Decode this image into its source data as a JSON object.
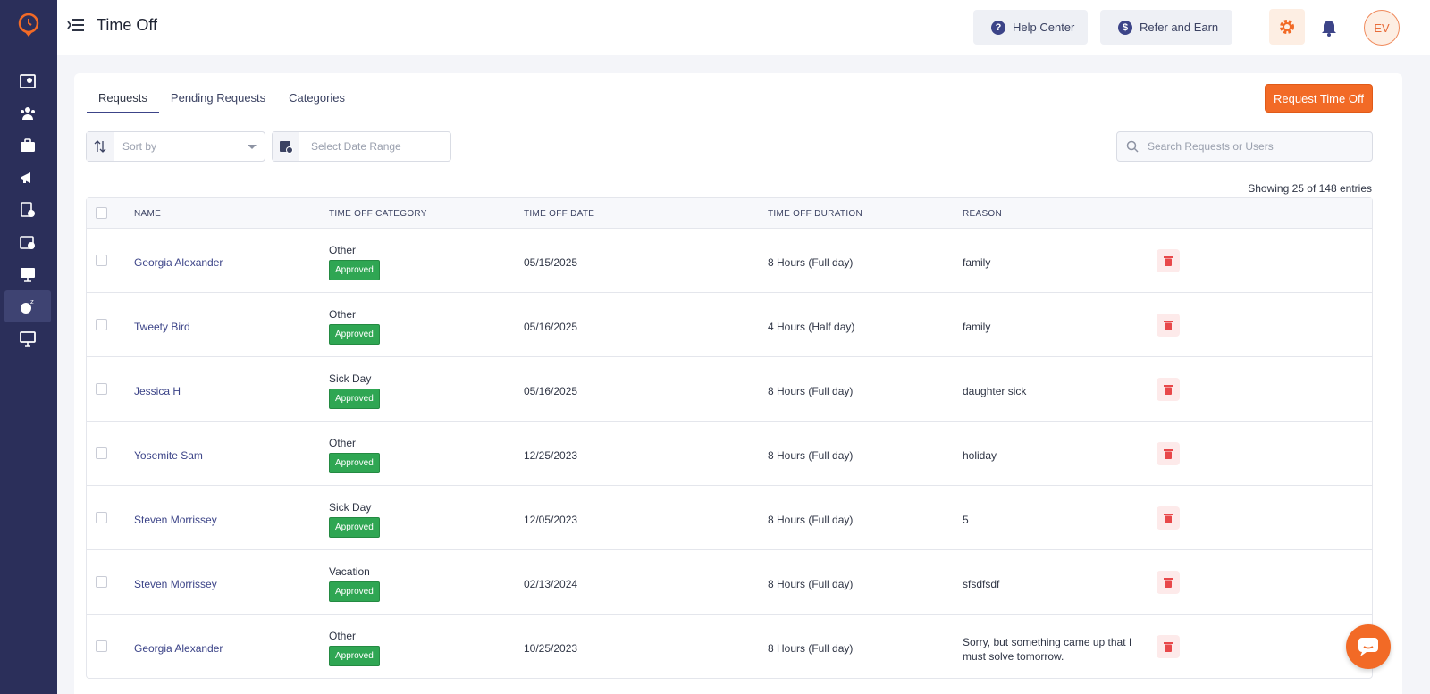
{
  "app": {
    "page_title": "Time Off",
    "accent_color": "#f26a26",
    "sidebar_color": "#2b2f5a"
  },
  "header": {
    "help_label": "Help Center",
    "refer_label": "Refer and Earn",
    "avatar_initials": "EV"
  },
  "tabs": [
    {
      "label": "Requests",
      "active": true
    },
    {
      "label": "Pending Requests",
      "active": false
    },
    {
      "label": "Categories",
      "active": false
    }
  ],
  "actions": {
    "request_label": "Request Time Off"
  },
  "filters": {
    "sort_placeholder": "Sort by",
    "date_placeholder": "Select Date Range",
    "search_placeholder": "Search Requests or Users"
  },
  "entries_text": "Showing 25 of 148 entries",
  "table": {
    "headers": {
      "name": "NAME",
      "category": "TIME OFF CATEGORY",
      "date": "TIME OFF DATE",
      "duration": "TIME OFF DURATION",
      "reason": "REASON"
    },
    "rows": [
      {
        "name": "Georgia Alexander",
        "category": "Other",
        "status": "Approved",
        "date": "05/15/2025",
        "duration": "8 Hours (Full day)",
        "reason": "family"
      },
      {
        "name": "Tweety Bird",
        "category": "Other",
        "status": "Approved",
        "date": "05/16/2025",
        "duration": "4 Hours (Half day)",
        "reason": "family"
      },
      {
        "name": "Jessica H",
        "category": "Sick Day",
        "status": "Approved",
        "date": "05/16/2025",
        "duration": "8 Hours (Full day)",
        "reason": "daughter sick"
      },
      {
        "name": "Yosemite Sam",
        "category": "Other",
        "status": "Approved",
        "date": "12/25/2023",
        "duration": "8 Hours (Full day)",
        "reason": "holiday"
      },
      {
        "name": "Steven Morrissey",
        "category": "Sick Day",
        "status": "Approved",
        "date": "12/05/2023",
        "duration": "8 Hours (Full day)",
        "reason": "5"
      },
      {
        "name": "Steven Morrissey",
        "category": "Vacation",
        "status": "Approved",
        "date": "02/13/2024",
        "duration": "8 Hours (Full day)",
        "reason": "sfsdfsdf"
      },
      {
        "name": "Georgia Alexander",
        "category": "Other",
        "status": "Approved",
        "date": "10/25/2023",
        "duration": "8 Hours (Full day)",
        "reason": "Sorry, but something came up that I must solve tomorrow."
      }
    ]
  }
}
